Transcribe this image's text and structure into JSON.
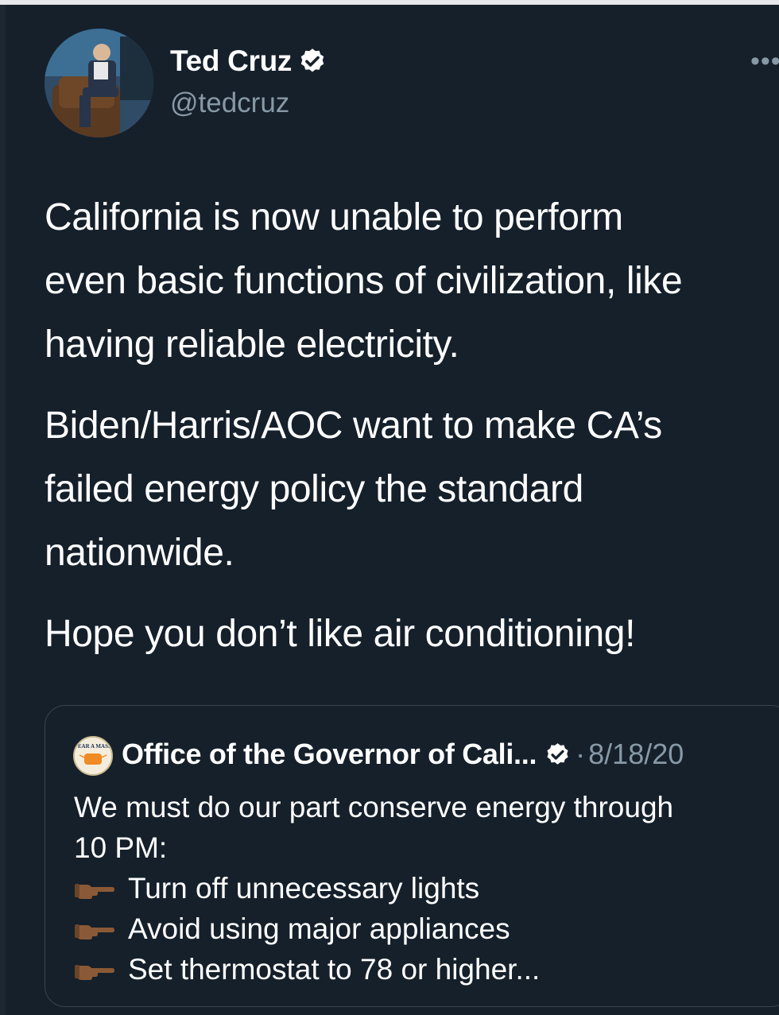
{
  "tweet": {
    "display_name": "Ted Cruz",
    "handle": "@tedcruz",
    "more_label": "•••",
    "paragraphs": [
      [
        "California is now unable to perform",
        "even basic functions of civilization, like",
        "having reliable electricity."
      ],
      [
        "Biden/Harris/AOC want to make CA’s",
        "failed energy policy the standard",
        "nationwide."
      ],
      [
        "Hope you don’t like air conditioning!"
      ]
    ]
  },
  "quote": {
    "display_name": "Office of the Governor of Cali...",
    "separator": "·",
    "date": "8/18/20",
    "avatar_text": "WEAR A MASK.",
    "intro_lines": [
      "We must do our part conserve energy through",
      "10 PM:"
    ],
    "bullets": [
      "Turn off unnecessary lights",
      "Avoid using major appliances",
      "Set thermostat to 78 or higher..."
    ]
  },
  "colors": {
    "background": "#15202b",
    "text": "#ffffff",
    "secondary_text": "#8899a6",
    "card_border": "#38444d",
    "verified_badge": "#ffffff"
  },
  "icons": {
    "verified": "verified-badge-icon",
    "more": "more-options-icon",
    "bullet": "pointing-hand-icon"
  }
}
